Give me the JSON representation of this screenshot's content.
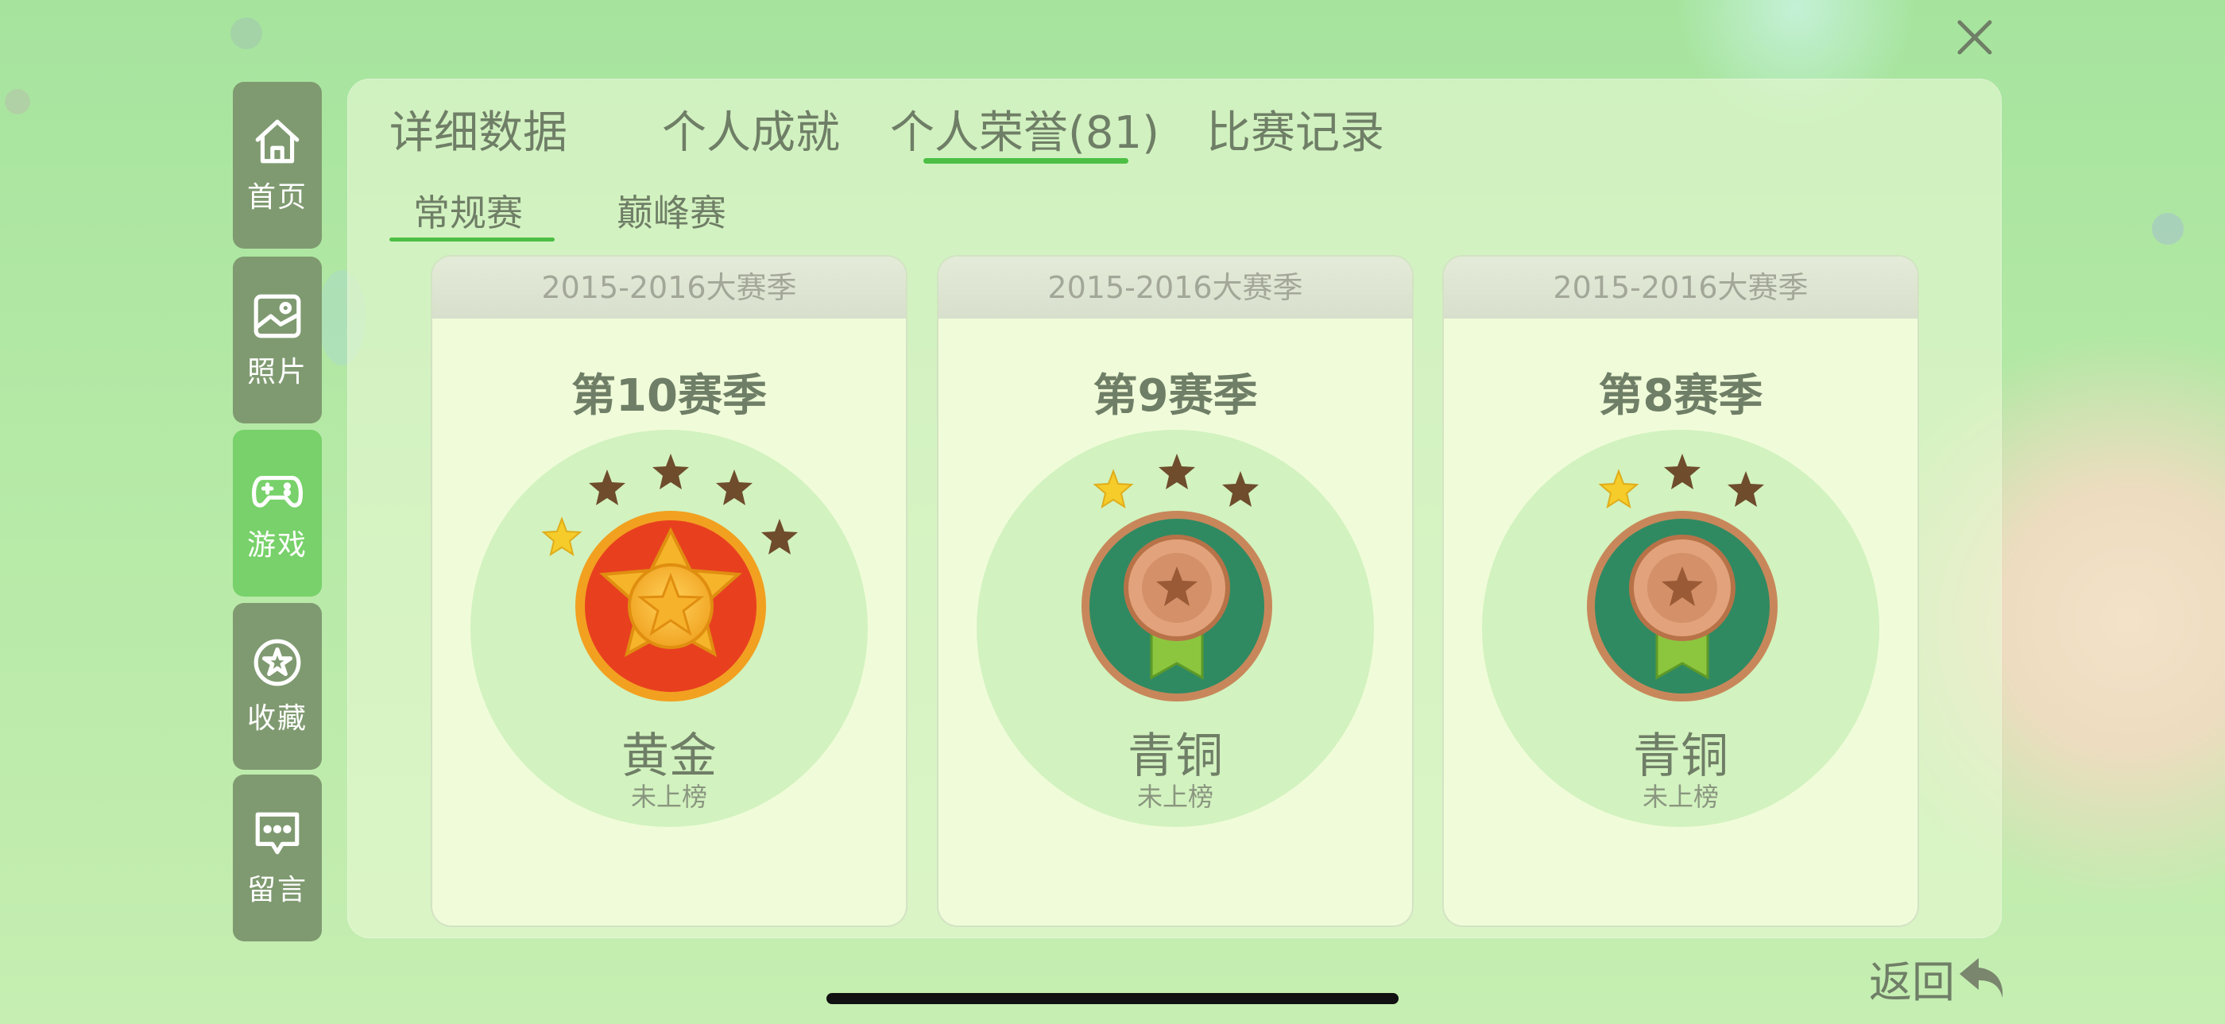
{
  "sidebar": {
    "items": [
      {
        "label": "首页",
        "icon": "home-icon",
        "active": false
      },
      {
        "label": "照片",
        "icon": "photo-icon",
        "active": false
      },
      {
        "label": "游戏",
        "icon": "gamepad-icon",
        "active": true
      },
      {
        "label": "收藏",
        "icon": "star-icon",
        "active": false
      },
      {
        "label": "留言",
        "icon": "message-icon",
        "active": false
      }
    ]
  },
  "tabs": [
    {
      "label": "详细数据"
    },
    {
      "label": "个人成就"
    },
    {
      "label": "个人荣誉(81)"
    },
    {
      "label": "比赛记录"
    }
  ],
  "subtabs": [
    {
      "label": "常规赛"
    },
    {
      "label": "巅峰赛"
    }
  ],
  "cards": [
    {
      "header": "2015-2016大赛季",
      "title": "第10赛季",
      "rank": "黄金",
      "status": "未上榜",
      "stars_earned": 1,
      "stars_total": 5,
      "medal": "gold"
    },
    {
      "header": "2015-2016大赛季",
      "title": "第9赛季",
      "rank": "青铜",
      "status": "未上榜",
      "stars_earned": 1,
      "stars_total": 3,
      "medal": "bronze"
    },
    {
      "header": "2015-2016大赛季",
      "title": "第8赛季",
      "rank": "青铜",
      "status": "未上榜",
      "stars_earned": 1,
      "stars_total": 3,
      "medal": "bronze"
    }
  ],
  "back": {
    "label": "返回"
  },
  "colors": {
    "accent_green": "#4dbf45",
    "sidebar_active": "#78d16a",
    "sidebar_default": "#7f9a70",
    "text": "#6f7e66"
  }
}
